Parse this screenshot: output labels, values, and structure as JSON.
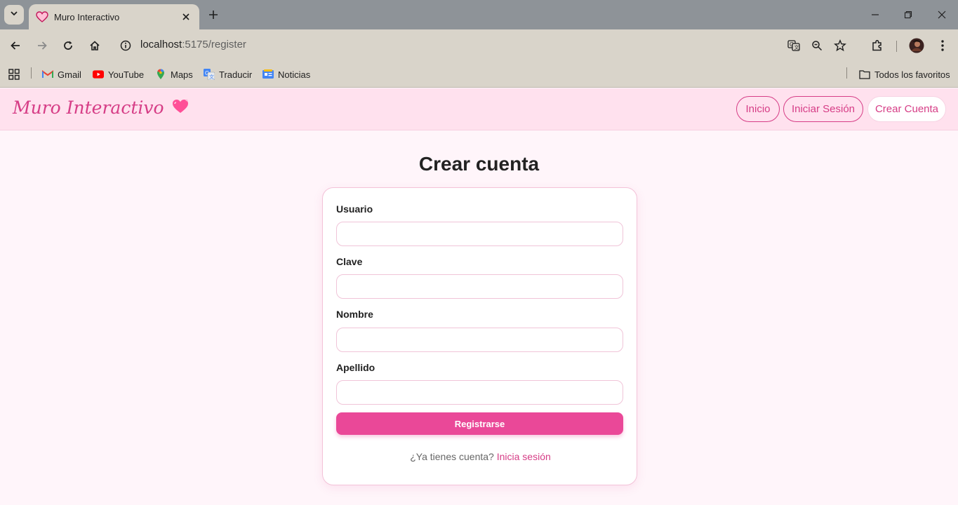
{
  "browser": {
    "tab_title": "Muro Interactivo",
    "url_host": "localhost",
    "url_path": ":5175/register",
    "bookmarks": [
      "Gmail",
      "YouTube",
      "Maps",
      "Traducir",
      "Noticias"
    ],
    "all_bookmarks_label": "Todos los favoritos"
  },
  "header": {
    "brand": "Muro Interactivo",
    "nav": [
      "Inicio",
      "Iniciar Sesión",
      "Crear Cuenta"
    ],
    "active_nav": "Crear Cuenta"
  },
  "form": {
    "title": "Crear cuenta",
    "fields": [
      {
        "label": "Usuario",
        "value": ""
      },
      {
        "label": "Clave",
        "value": ""
      },
      {
        "label": "Nombre",
        "value": ""
      },
      {
        "label": "Apellido",
        "value": ""
      }
    ],
    "submit_label": "Registrarse",
    "footer_prompt": "¿Ya tienes cuenta?",
    "footer_link": "Inicia sesión"
  },
  "colors": {
    "accent": "#d63d86",
    "button": "#ea4898",
    "header_bg": "#ffe1ee",
    "page_bg": "#fff5fa"
  }
}
